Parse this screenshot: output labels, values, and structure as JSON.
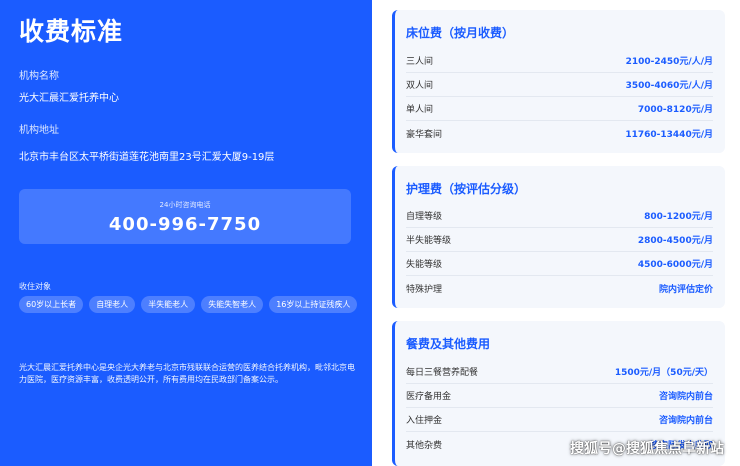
{
  "left": {
    "title": "收费标准",
    "name_label": "机构名称",
    "name_value": "光大汇晨汇爱托养中心",
    "addr_label": "机构地址",
    "addr_value": "北京市丰台区太平桥街道莲花池南里23号汇爱大厦9-19层",
    "hotline_caption": "24小时咨询电话",
    "hotline_number": "400-996-7750",
    "tags_label": "收住对象",
    "tags": [
      "60岁以上长者",
      "自理老人",
      "半失能老人",
      "失能失智老人",
      "16岁以上持证残疾人"
    ],
    "description": "光大汇晨汇爱托养中心是央企光大养老与北京市残联联合运营的医养结合托养机构，毗邻北京电力医院，医疗资源丰富，收费透明公开，所有费用均在民政部门备案公示。"
  },
  "cards": [
    {
      "title": "床位费（按月收费）",
      "rows": [
        {
          "k": "三人间",
          "v": "2100-2450元/人/月"
        },
        {
          "k": "双人间",
          "v": "3500-4060元/人/月"
        },
        {
          "k": "单人间",
          "v": "7000-8120元/月"
        },
        {
          "k": "豪华套间",
          "v": "11760-13440元/月"
        }
      ]
    },
    {
      "title": "护理费（按评估分级）",
      "rows": [
        {
          "k": "自理等级",
          "v": "800-1200元/月"
        },
        {
          "k": "半失能等级",
          "v": "2800-4500元/月"
        },
        {
          "k": "失能等级",
          "v": "4500-6000元/月"
        },
        {
          "k": "特殊护理",
          "v": "院内评估定价"
        }
      ]
    },
    {
      "title": "餐费及其他费用",
      "rows": [
        {
          "k": "每日三餐营养配餐",
          "v": "1500元/月（50元/天）"
        },
        {
          "k": "医疗备用金",
          "v": "咨询院内前台"
        },
        {
          "k": "入住押金",
          "v": "咨询院内前台"
        },
        {
          "k": "其他杂费",
          "v": "按实际发生收取"
        }
      ]
    }
  ],
  "watermark": "搜狐号@搜狐焦点阜新站",
  "colors": {
    "primary": "#1b5cff",
    "card_bg": "#f4f7fc"
  }
}
